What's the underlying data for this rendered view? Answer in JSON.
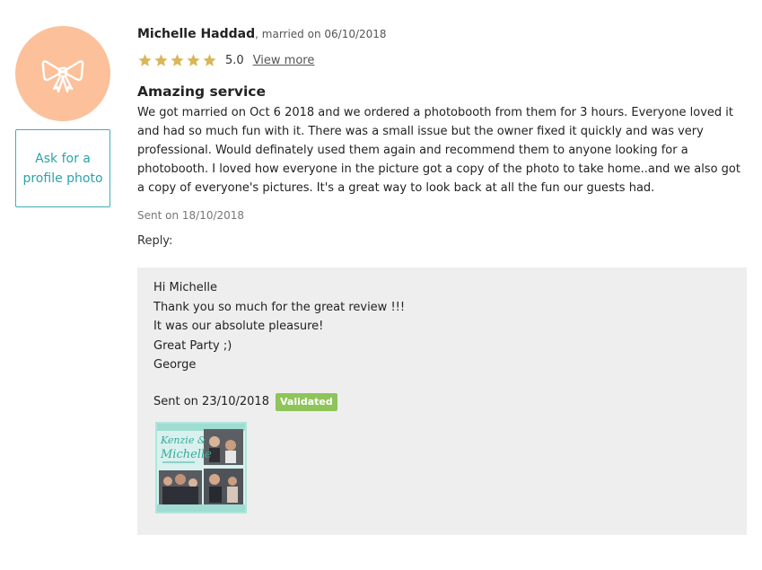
{
  "reviewer": {
    "name": "Michelle Haddad",
    "married_on": ", married on 06/10/2018"
  },
  "avatar": {
    "icon": "bow-icon",
    "color": "#fcc09a"
  },
  "ask_photo_label": "Ask for a profile photo",
  "rating": {
    "value": "5.0",
    "stars": 5,
    "star_color": "#d9b65a",
    "view_more_label": "View more"
  },
  "review": {
    "title": "Amazing service",
    "body": "We got married on Oct 6 2018 and we ordered a photobooth from them for 3 hours. Everyone loved it and had so much fun with it. There was a small issue but the owner fixed it quickly and was very professional. Would definately used them again and recommend them to anyone looking for a photobooth. I loved how everyone in the picture got a copy of the photo to take home..and we also got a copy of everyone's pictures. It's a great way to look back at all the fun our guests had.",
    "sent_on": "Sent on 18/10/2018"
  },
  "reply": {
    "label": "Reply:",
    "lines": [
      "Hi Michelle",
      "Thank you so much for the great review !!!",
      "It was our absolute pleasure!",
      "Great Party ;)",
      "George"
    ],
    "sent_on": "Sent on 23/10/2018",
    "badge": "Validated",
    "badge_color": "#8fc45a",
    "photo_script_text": "Kenzie & Michelle"
  }
}
